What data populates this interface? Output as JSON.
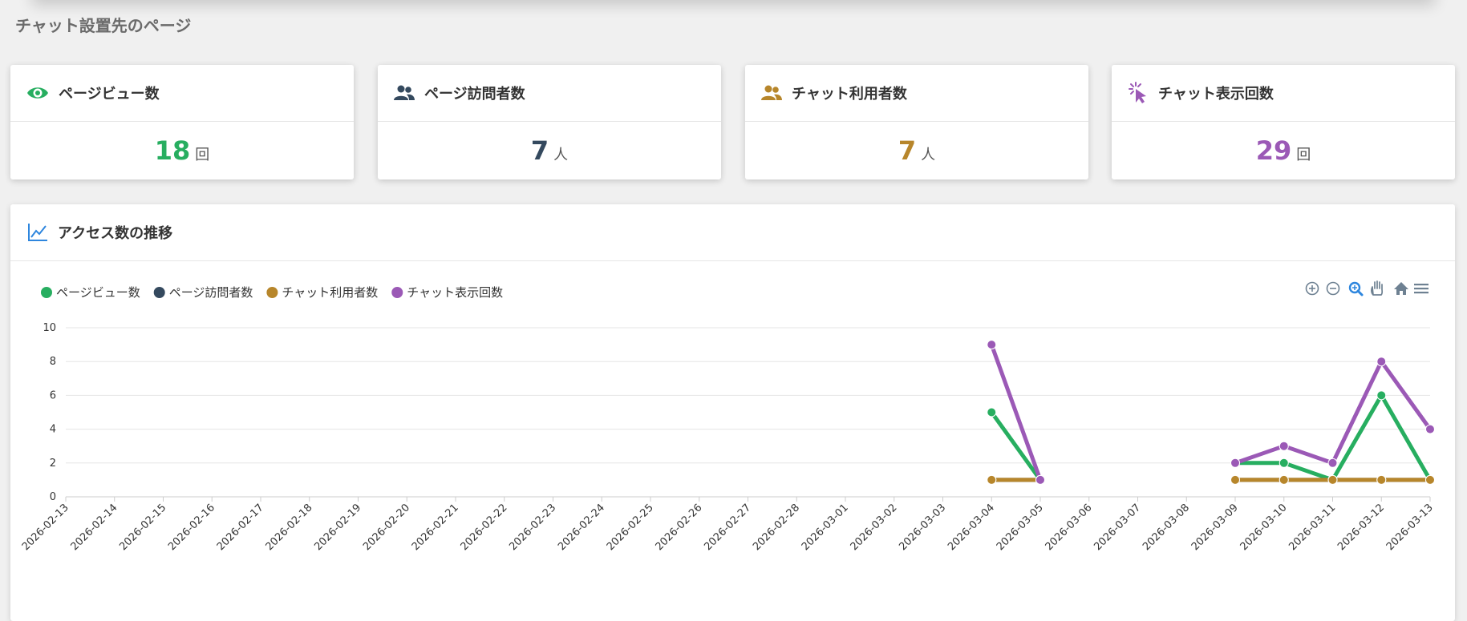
{
  "page": {
    "title": "チャット設置先のページ"
  },
  "cards": [
    {
      "label": "ページビュー数",
      "value": "18",
      "unit": "回",
      "color": "#27ae60",
      "icon": "eye-icon"
    },
    {
      "label": "ページ訪問者数",
      "value": "7",
      "unit": "人",
      "color": "#34495e",
      "icon": "users-icon"
    },
    {
      "label": "チャット利用者数",
      "value": "7",
      "unit": "人",
      "color": "#b7862b",
      "icon": "users-icon"
    },
    {
      "label": "チャット表示回数",
      "value": "29",
      "unit": "回",
      "color": "#9b59b6",
      "icon": "click-pointer-icon"
    }
  ],
  "chart_panel": {
    "title": "アクセス数の推移",
    "icon": "line-chart-icon"
  },
  "toolbar": [
    "zoom-in-icon",
    "zoom-out-icon",
    "zoom-selection-icon",
    "pan-hand-icon",
    "home-icon",
    "menu-icon"
  ],
  "chart_data": {
    "type": "line",
    "title": "",
    "xlabel": "",
    "ylabel": "",
    "ylim": [
      0,
      10
    ],
    "yticks": [
      "0",
      "2",
      "4",
      "6",
      "8",
      "10"
    ],
    "grid": true,
    "legend_position": "top-left",
    "categories": [
      "2026-02-13",
      "2026-02-14",
      "2026-02-15",
      "2026-02-16",
      "2026-02-17",
      "2026-02-18",
      "2026-02-19",
      "2026-02-20",
      "2026-02-21",
      "2026-02-22",
      "2026-02-23",
      "2026-02-24",
      "2026-02-25",
      "2026-02-26",
      "2026-02-27",
      "2026-02-28",
      "2026-03-01",
      "2026-03-02",
      "2026-03-03",
      "2026-03-04",
      "2026-03-05",
      "2026-03-06",
      "2026-03-07",
      "2026-03-08",
      "2026-03-09",
      "2026-03-10",
      "2026-03-11",
      "2026-03-12",
      "2026-03-13"
    ],
    "series": [
      {
        "name": "ページビュー数",
        "color": "#27ae60",
        "points": [
          [
            "2026-03-04",
            5
          ],
          [
            "2026-03-05",
            1
          ],
          [
            "2026-03-09",
            2
          ],
          [
            "2026-03-10",
            2
          ],
          [
            "2026-03-11",
            1
          ],
          [
            "2026-03-12",
            6
          ],
          [
            "2026-03-13",
            1
          ]
        ]
      },
      {
        "name": "ページ訪問者数",
        "color": "#34495e",
        "points": [
          [
            "2026-03-04",
            1
          ],
          [
            "2026-03-05",
            1
          ],
          [
            "2026-03-09",
            1
          ],
          [
            "2026-03-10",
            1
          ],
          [
            "2026-03-11",
            1
          ],
          [
            "2026-03-12",
            1
          ],
          [
            "2026-03-13",
            1
          ]
        ]
      },
      {
        "name": "チャット利用者数",
        "color": "#b7862b",
        "points": [
          [
            "2026-03-04",
            1
          ],
          [
            "2026-03-05",
            1
          ],
          [
            "2026-03-09",
            1
          ],
          [
            "2026-03-10",
            1
          ],
          [
            "2026-03-11",
            1
          ],
          [
            "2026-03-12",
            1
          ],
          [
            "2026-03-13",
            1
          ]
        ]
      },
      {
        "name": "チャット表示回数",
        "color": "#9b59b6",
        "points": [
          [
            "2026-03-04",
            9
          ],
          [
            "2026-03-05",
            1
          ],
          [
            "2026-03-09",
            2
          ],
          [
            "2026-03-10",
            3
          ],
          [
            "2026-03-11",
            2
          ],
          [
            "2026-03-12",
            8
          ],
          [
            "2026-03-13",
            4
          ]
        ]
      }
    ]
  }
}
